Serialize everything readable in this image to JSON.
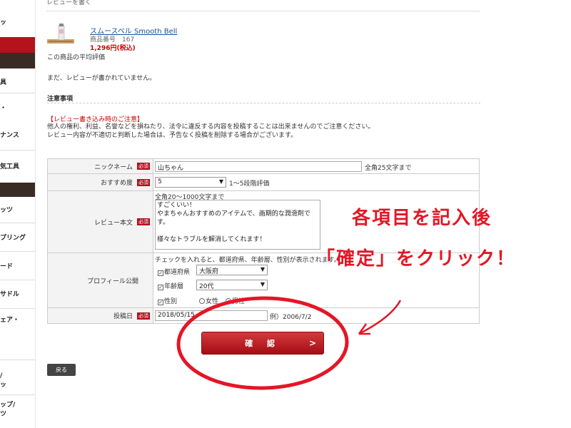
{
  "sidebar": {
    "items": [
      "ッ",
      "具",
      "・",
      "ナンス",
      "気工具",
      "ッツ",
      "プリング",
      "ード",
      "サドル",
      "ェア・",
      "/",
      "ッ",
      "ップ/",
      "ツ"
    ]
  },
  "review": {
    "heading": "レビューを書く"
  },
  "product": {
    "name": "スムースベル Smooth Bell",
    "code": "商品番号　167",
    "price": "1,296円(税込)"
  },
  "average_label": "この商品の平均評価",
  "no_review": "まだ、レビューが書かれていません。",
  "notice": {
    "title": "注意事項",
    "head": "【レビュー書き込み時のご注意】",
    "line1": "他人の権利、利益、名誉などを損ねたり、法令に違反する内容を投稿することは出来ませんのでご注意ください。",
    "line2": "レビュー内容が不適切と判断した場合は、予告なく投稿を削除する場合がございます。"
  },
  "form": {
    "required_badge": "必須",
    "nickname": {
      "label": "ニックネーム",
      "value": "山ちゃん",
      "hint": "全角25文字まで"
    },
    "rating": {
      "label": "おすすめ度",
      "value": "5",
      "hint": "1～5段階評価"
    },
    "body": {
      "label": "レビュー本文",
      "hint": "全角20～1000文字まで",
      "line1": "すごくいい！",
      "line2": "やまちゃんおすすめのアイテムで、画期的な潤滑剤です。",
      "line3": "",
      "line4": "様々なトラブルを解消してくれます！"
    },
    "profile": {
      "label": "プロフィール公開",
      "hint": "チェックを入れると、都道府県、年齢層、性別が表示されます。",
      "pref_label": "都道府県",
      "pref_value": "大阪府",
      "age_label": "年齢層",
      "age_value": "20代",
      "gender_label": "性別",
      "female": "女性",
      "male": "男性"
    },
    "date": {
      "label": "投稿日",
      "value": "2018/05/15",
      "hint": "例）2006/7/2"
    }
  },
  "buttons": {
    "confirm": "確 認",
    "confirm_chevron": ">",
    "back": "戻る"
  },
  "annotation": {
    "line1": "各項目を記入後",
    "line2": "「確定」をクリック！",
    "color": "#e41626"
  }
}
